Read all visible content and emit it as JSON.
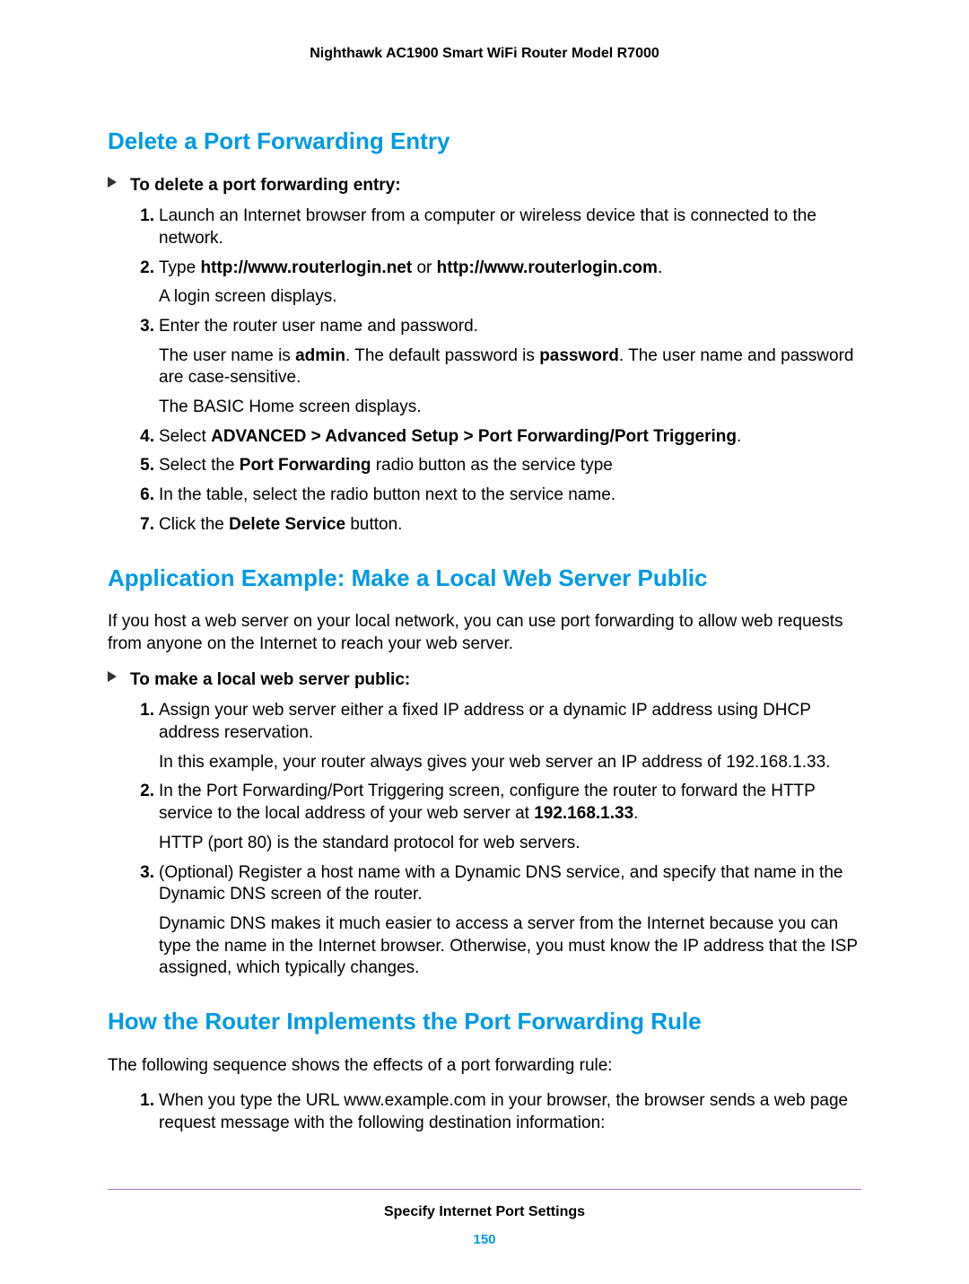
{
  "header": {
    "product": "Nighthawk AC1900 Smart WiFi Router Model R7000"
  },
  "section1": {
    "heading": "Delete a Port Forwarding Entry",
    "task": "To delete a port forwarding entry:",
    "steps": {
      "s1": {
        "num": "1.",
        "text": "Launch an Internet browser from a computer or wireless device that is connected to the network."
      },
      "s2": {
        "num": "2.",
        "pre": "Type ",
        "b1": "http://www.routerlogin.net",
        "mid": " or ",
        "b2": "http://www.routerlogin.com",
        "post": ".",
        "p1": "A login screen displays."
      },
      "s3": {
        "num": "3.",
        "text": "Enter the router user name and password.",
        "p1a": "The user name is ",
        "p1b": "admin",
        "p1c": ". The default password is ",
        "p1d": "password",
        "p1e": ". The user name and password are case-sensitive.",
        "p2": "The BASIC Home screen displays."
      },
      "s4": {
        "num": "4.",
        "pre": "Select ",
        "b": "ADVANCED > Advanced Setup > Port Forwarding/Port Triggering",
        "post": "."
      },
      "s5": {
        "num": "5.",
        "pre": "Select the ",
        "b": "Port Forwarding",
        "post": " radio button as the service type"
      },
      "s6": {
        "num": "6.",
        "text": "In the table, select the radio button next to the service name."
      },
      "s7": {
        "num": "7.",
        "pre": "Click the ",
        "b": "Delete Service",
        "post": " button."
      }
    }
  },
  "section2": {
    "heading": "Application Example: Make a Local Web Server Public",
    "intro": "If you host a web server on your local network, you can use port forwarding to allow web requests from anyone on the Internet to reach your web server.",
    "task": "To make a local web server public:",
    "steps": {
      "s1": {
        "num": "1.",
        "text": "Assign your web server either a fixed IP address or a dynamic IP address using DHCP address reservation.",
        "p1": "In this example, your router always gives your web server an IP address of 192.168.1.33."
      },
      "s2": {
        "num": "2.",
        "pre": "In the Port Forwarding/Port Triggering screen, configure the router to forward the HTTP service to the local address of your web server at ",
        "b": "192.168.1.33",
        "post": ".",
        "p1": "HTTP (port 80) is the standard protocol for web servers."
      },
      "s3": {
        "num": "3.",
        "text": "(Optional) Register a host name with a Dynamic DNS service, and specify that name in the Dynamic DNS screen of the router.",
        "p1": "Dynamic DNS makes it much easier to access a server from the Internet because you can type the name in the Internet browser. Otherwise, you must know the IP address that the ISP assigned, which typically changes."
      }
    }
  },
  "section3": {
    "heading": "How the Router Implements the Port Forwarding Rule",
    "intro": "The following sequence shows the effects of a port forwarding rule:",
    "steps": {
      "s1": {
        "num": "1.",
        "text": "When you type the URL www.example.com in your browser, the browser sends a web page request message with the following destination information:"
      }
    }
  },
  "footer": {
    "chapter": "Specify Internet Port Settings",
    "page": "150"
  }
}
